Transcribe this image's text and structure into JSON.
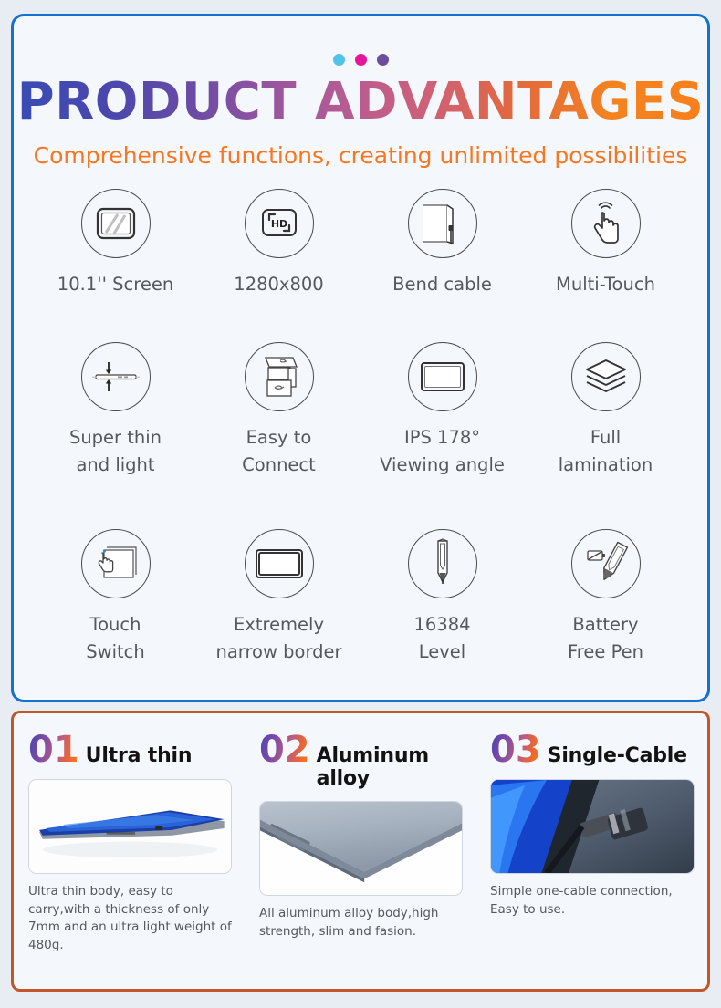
{
  "theme": {
    "page_background": "#e8edf4",
    "panel_background": "#f4f7fb",
    "top_border_color": "#1471ce",
    "bottom_border_color": "#c1562a",
    "subtitle_color": "#f7761f",
    "label_color": "#55585c",
    "title_gradient_start": "#3a4bb5",
    "title_gradient_end": "#f97f1c"
  },
  "header": {
    "dots": [
      {
        "name": "dot-cyan",
        "color": "#4fc3e8"
      },
      {
        "name": "dot-magenta",
        "color": "#e6159b"
      },
      {
        "name": "dot-purple",
        "color": "#6b4d9e"
      }
    ],
    "title": "PRODUCT ADVANTAGES",
    "subtitle": "Comprehensive functions, creating unlimited possibilities"
  },
  "features": [
    {
      "icon": "tablet-screen-icon",
      "label": "10.1'' Screen"
    },
    {
      "icon": "hd-resolution-icon",
      "label": "1280x800"
    },
    {
      "icon": "bend-cable-icon",
      "label": "Bend cable"
    },
    {
      "icon": "multi-touch-hand-icon",
      "label": "Multi-Touch"
    },
    {
      "icon": "thin-profile-icon",
      "label": "Super thin\nand light"
    },
    {
      "icon": "easy-connect-icon",
      "label": "Easy to\nConnect"
    },
    {
      "icon": "ips-viewing-angle-icon",
      "label": "IPS 178°\nViewing angle"
    },
    {
      "icon": "full-lamination-layers-icon",
      "label": "Full\nlamination"
    },
    {
      "icon": "touch-switch-icon",
      "label": "Touch\nSwitch"
    },
    {
      "icon": "narrow-border-icon",
      "label": "Extremely\nnarrow border"
    },
    {
      "icon": "stylus-pressure-icon",
      "label": "16384\nLevel"
    },
    {
      "icon": "battery-free-pen-icon",
      "label": "Battery\nFree Pen"
    }
  ],
  "highlights": [
    {
      "number": "01",
      "title": "Ultra thin",
      "photo": "thin-tablet-profile-photo",
      "caption": "Ultra thin body, easy to carry,with a thickness of only 7mm and an ultra light weight of 480g."
    },
    {
      "number": "02",
      "title": "Aluminum alloy",
      "photo": "aluminum-body-corner-photo",
      "caption": "All aluminum alloy body,high strength, slim and fasion."
    },
    {
      "number": "03",
      "title": "Single-Cable",
      "photo": "usb-c-cable-connection-photo",
      "caption": "Simple one-cable connection, Easy to use."
    }
  ]
}
